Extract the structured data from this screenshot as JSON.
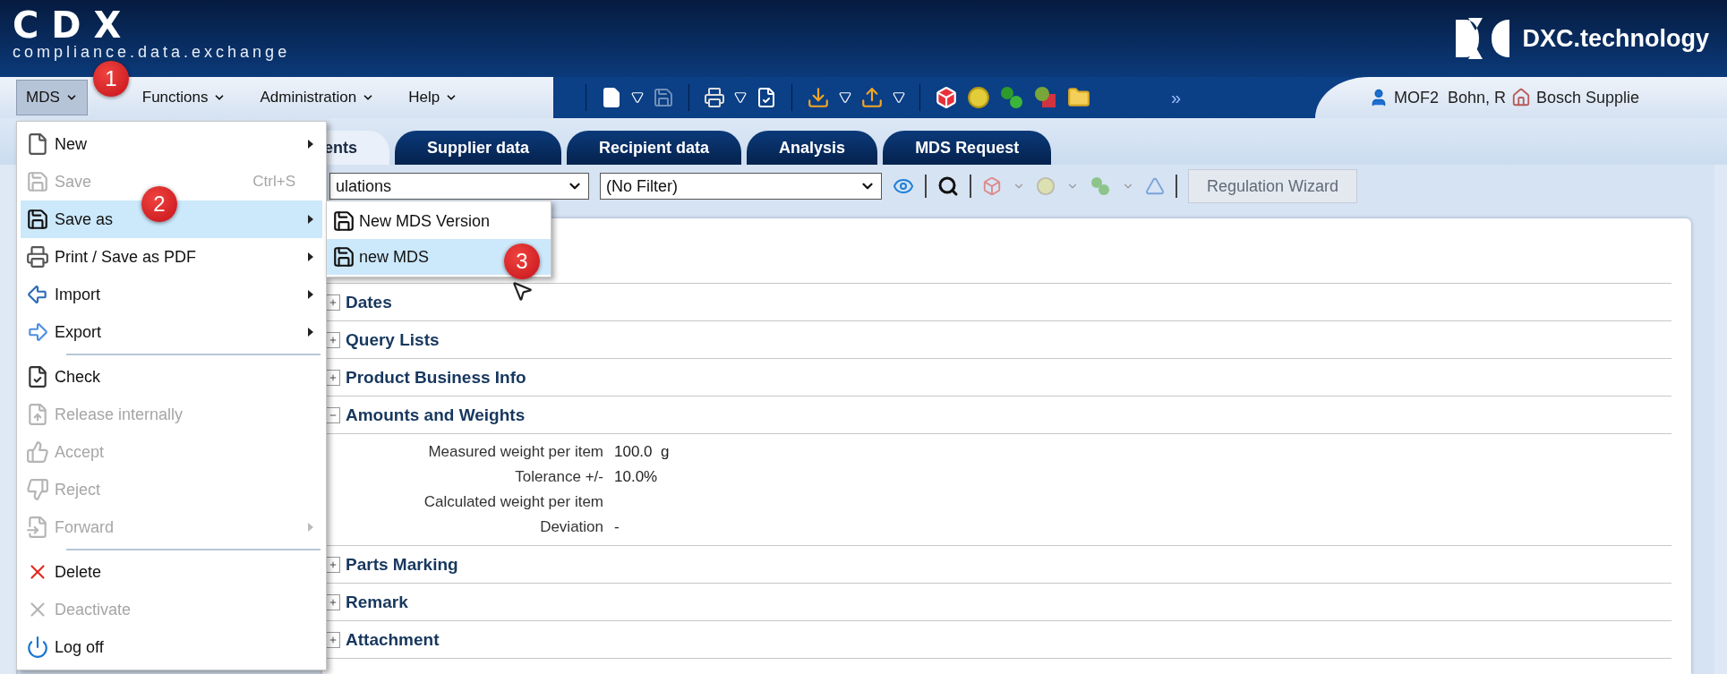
{
  "header": {
    "logo": "CDX",
    "tagline": "compliance.data.exchange",
    "brand": "DXC.technology"
  },
  "menubar": [
    {
      "label": "MDS",
      "selected": true
    },
    {
      "label": "Functions",
      "selected": false
    },
    {
      "label": "Administration",
      "selected": false
    },
    {
      "label": "Help",
      "selected": false
    }
  ],
  "toolbar_more": "»",
  "user": {
    "name": "MOF2  Bohn, R",
    "company": "Bosch Supplie"
  },
  "tabs": [
    {
      "label": "ents",
      "selected": true
    },
    {
      "label": "Supplier data",
      "selected": false
    },
    {
      "label": "Recipient data",
      "selected": false
    },
    {
      "label": "Analysis",
      "selected": false
    },
    {
      "label": "MDS Request",
      "selected": false
    }
  ],
  "filters": [
    {
      "value": "ulations"
    },
    {
      "value": "(No Filter)"
    }
  ],
  "wizard_button": {
    "label": "Regulation Wizard",
    "disabled": true
  },
  "sections": [
    {
      "title": "Dates",
      "expanded": false
    },
    {
      "title": "Query Lists",
      "expanded": false
    },
    {
      "title": "Product Business Info",
      "expanded": false
    },
    {
      "title": "Amounts and Weights",
      "expanded": true,
      "fields": [
        {
          "label": "Measured weight per item",
          "value": "100.0  g"
        },
        {
          "label": "Tolerance +/-",
          "value": "10.0%"
        },
        {
          "label": "Calculated weight per item"
        },
        {
          "label": "Deviation",
          "value": "-"
        }
      ]
    },
    {
      "title": "Parts Marking",
      "expanded": false
    },
    {
      "title": "Remark",
      "expanded": false
    },
    {
      "title": "Attachment",
      "expanded": false
    }
  ],
  "mds_menu": [
    {
      "kind": "item",
      "label": "New",
      "submenu": true,
      "disabled": false,
      "selected": false
    },
    {
      "kind": "item",
      "label": "Save",
      "shortcut": "Ctrl+S",
      "submenu": false,
      "disabled": true,
      "selected": false
    },
    {
      "kind": "item",
      "label": "Save as",
      "submenu": true,
      "disabled": false,
      "selected": true
    },
    {
      "kind": "item",
      "label": "Print / Save as PDF",
      "submenu": true,
      "disabled": false,
      "selected": false
    },
    {
      "kind": "item",
      "label": "Import",
      "submenu": true,
      "disabled": false,
      "selected": false
    },
    {
      "kind": "item",
      "label": "Export",
      "submenu": true,
      "disabled": false,
      "selected": false
    },
    {
      "kind": "separator"
    },
    {
      "kind": "item",
      "label": "Check",
      "submenu": false,
      "disabled": false,
      "selected": false
    },
    {
      "kind": "item",
      "label": "Release internally",
      "submenu": false,
      "disabled": true,
      "selected": false
    },
    {
      "kind": "item",
      "label": "Accept",
      "submenu": false,
      "disabled": true,
      "selected": false
    },
    {
      "kind": "item",
      "label": "Reject",
      "submenu": false,
      "disabled": true,
      "selected": false
    },
    {
      "kind": "item",
      "label": "Forward",
      "submenu": true,
      "disabled": true,
      "selected": false
    },
    {
      "kind": "separator"
    },
    {
      "kind": "item",
      "label": "Delete",
      "submenu": false,
      "disabled": false,
      "selected": false
    },
    {
      "kind": "item",
      "label": "Deactivate",
      "submenu": false,
      "disabled": true,
      "selected": false
    },
    {
      "kind": "item",
      "label": "Log off",
      "submenu": false,
      "disabled": false,
      "selected": false
    }
  ],
  "submenu": [
    {
      "label": "New MDS Version",
      "selected": false
    },
    {
      "label": "new MDS",
      "selected": true
    }
  ],
  "badges": [
    "1",
    "2",
    "3"
  ]
}
